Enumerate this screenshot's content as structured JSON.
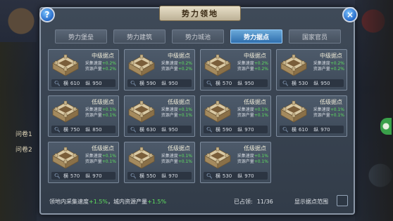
{
  "dialog": {
    "title": "势力领地",
    "help_label": "?",
    "close_label": "×"
  },
  "tabs": [
    {
      "label": "势力堡垒",
      "active": false
    },
    {
      "label": "势力建筑",
      "active": false
    },
    {
      "label": "势力城池",
      "active": false
    },
    {
      "label": "势力据点",
      "active": true
    },
    {
      "label": "国家官员",
      "active": false
    }
  ],
  "cards": [
    {
      "name": "中级据点",
      "collect_label": "采集速度",
      "collect_bonus": "+0.2%",
      "resource_label": "资源产量",
      "resource_bonus": "+0.2%",
      "x_label": "横",
      "x": "610",
      "y_label": "纵",
      "y": "950"
    },
    {
      "name": "中级据点",
      "collect_label": "采集速度",
      "collect_bonus": "+0.2%",
      "resource_label": "资源产量",
      "resource_bonus": "+0.2%",
      "x_label": "横",
      "x": "590",
      "y_label": "纵",
      "y": "950"
    },
    {
      "name": "中级据点",
      "collect_label": "采集速度",
      "collect_bonus": "+0.2%",
      "resource_label": "资源产量",
      "resource_bonus": "+0.2%",
      "x_label": "横",
      "x": "570",
      "y_label": "纵",
      "y": "950"
    },
    {
      "name": "中级据点",
      "collect_label": "采集速度",
      "collect_bonus": "+0.2%",
      "resource_label": "资源产量",
      "resource_bonus": "+0.2%",
      "x_label": "横",
      "x": "530",
      "y_label": "纵",
      "y": "950"
    },
    {
      "name": "低级据点",
      "collect_label": "采集速度",
      "collect_bonus": "+0.1%",
      "resource_label": "资源产量",
      "resource_bonus": "+0.1%",
      "x_label": "横",
      "x": "750",
      "y_label": "纵",
      "y": "850"
    },
    {
      "name": "低级据点",
      "collect_label": "采集速度",
      "collect_bonus": "+0.1%",
      "resource_label": "资源产量",
      "resource_bonus": "+0.1%",
      "x_label": "横",
      "x": "630",
      "y_label": "纵",
      "y": "950"
    },
    {
      "name": "低级据点",
      "collect_label": "采集速度",
      "collect_bonus": "+0.1%",
      "resource_label": "资源产量",
      "resource_bonus": "+0.1%",
      "x_label": "横",
      "x": "590",
      "y_label": "纵",
      "y": "970"
    },
    {
      "name": "低级据点",
      "collect_label": "采集速度",
      "collect_bonus": "+0.1%",
      "resource_label": "资源产量",
      "resource_bonus": "+0.1%",
      "x_label": "横",
      "x": "610",
      "y_label": "纵",
      "y": "970"
    },
    {
      "name": "低级据点",
      "collect_label": "采集速度",
      "collect_bonus": "+0.1%",
      "resource_label": "资源产量",
      "resource_bonus": "+0.1%",
      "x_label": "横",
      "x": "570",
      "y_label": "纵",
      "y": "970"
    },
    {
      "name": "低级据点",
      "collect_label": "采集速度",
      "collect_bonus": "+0.1%",
      "resource_label": "资源产量",
      "resource_bonus": "+0.1%",
      "x_label": "横",
      "x": "550",
      "y_label": "纵",
      "y": "970"
    },
    {
      "name": "低级据点",
      "collect_label": "采集速度",
      "collect_bonus": "+0.1%",
      "resource_label": "资源产量",
      "resource_bonus": "+0.1%",
      "x_label": "横",
      "x": "530",
      "y_label": "纵",
      "y": "970"
    }
  ],
  "footer": {
    "summary_prefix": "领地内采集速度",
    "summary_collect": "+1.5%",
    "summary_mid": "，城内资源产量",
    "summary_resource": "+1.5%",
    "occupied_label": "已占领:",
    "occupied_value": "11/36",
    "toggle_label": "显示据点范围"
  },
  "background": {
    "side_text_1": "问卷1",
    "side_text_2": "问卷2"
  },
  "colors": {
    "accent_tab": "#2f6fae",
    "bonus_green": "#5fe05f",
    "title_plate": "#e7dfc8"
  },
  "icons": {
    "card_icon": "fortress-icon",
    "coord_icon": "magnifier-icon",
    "help": "question-icon",
    "close": "close-icon"
  }
}
